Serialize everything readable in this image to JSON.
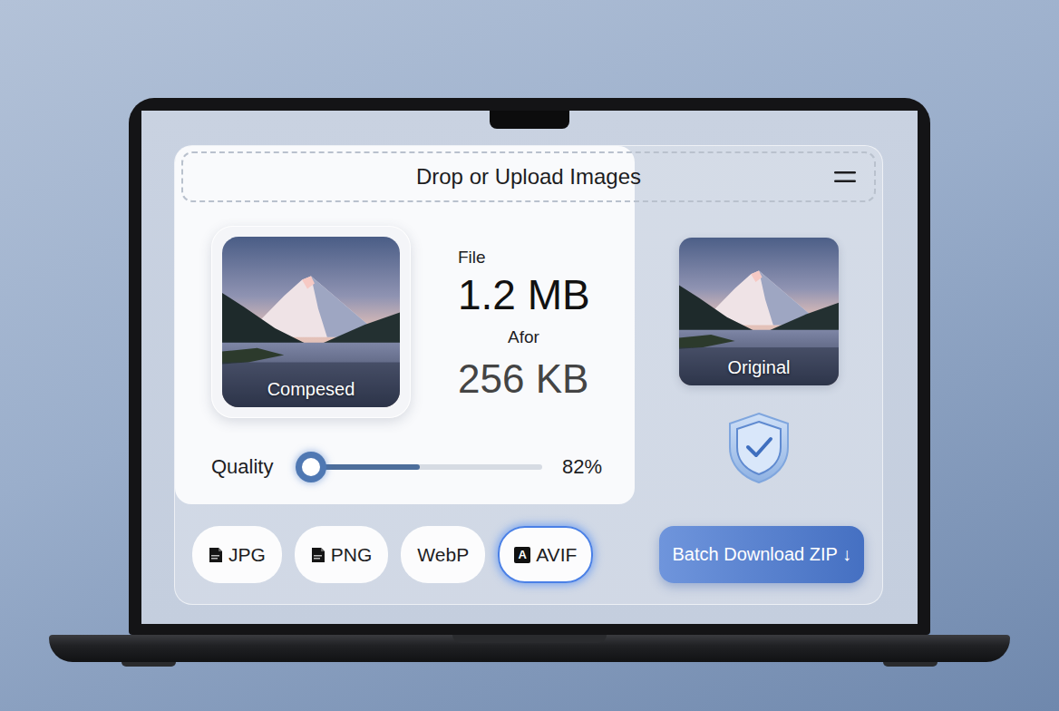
{
  "dropzone": {
    "label": "Drop or Upload Images"
  },
  "preview": {
    "compressed_label": "Compesed",
    "original_label": "Original"
  },
  "file_info": {
    "file_label": "File",
    "original_size": "1.2 MB",
    "after_label": "Afor",
    "compressed_size": "256 KB"
  },
  "quality": {
    "label": "Quality",
    "level": 0.47,
    "reading": "82%"
  },
  "formats": [
    {
      "label": "JPG",
      "kind": "doc",
      "selected": false
    },
    {
      "label": "PNG",
      "kind": "doc",
      "selected": false
    },
    {
      "label": "WebP",
      "kind": "plain",
      "selected": false
    },
    {
      "label": "AVIF",
      "kind": "letter",
      "icon_text": "A",
      "selected": true
    }
  ],
  "download_button": {
    "label": "Batch Download ZIP ↓"
  }
}
